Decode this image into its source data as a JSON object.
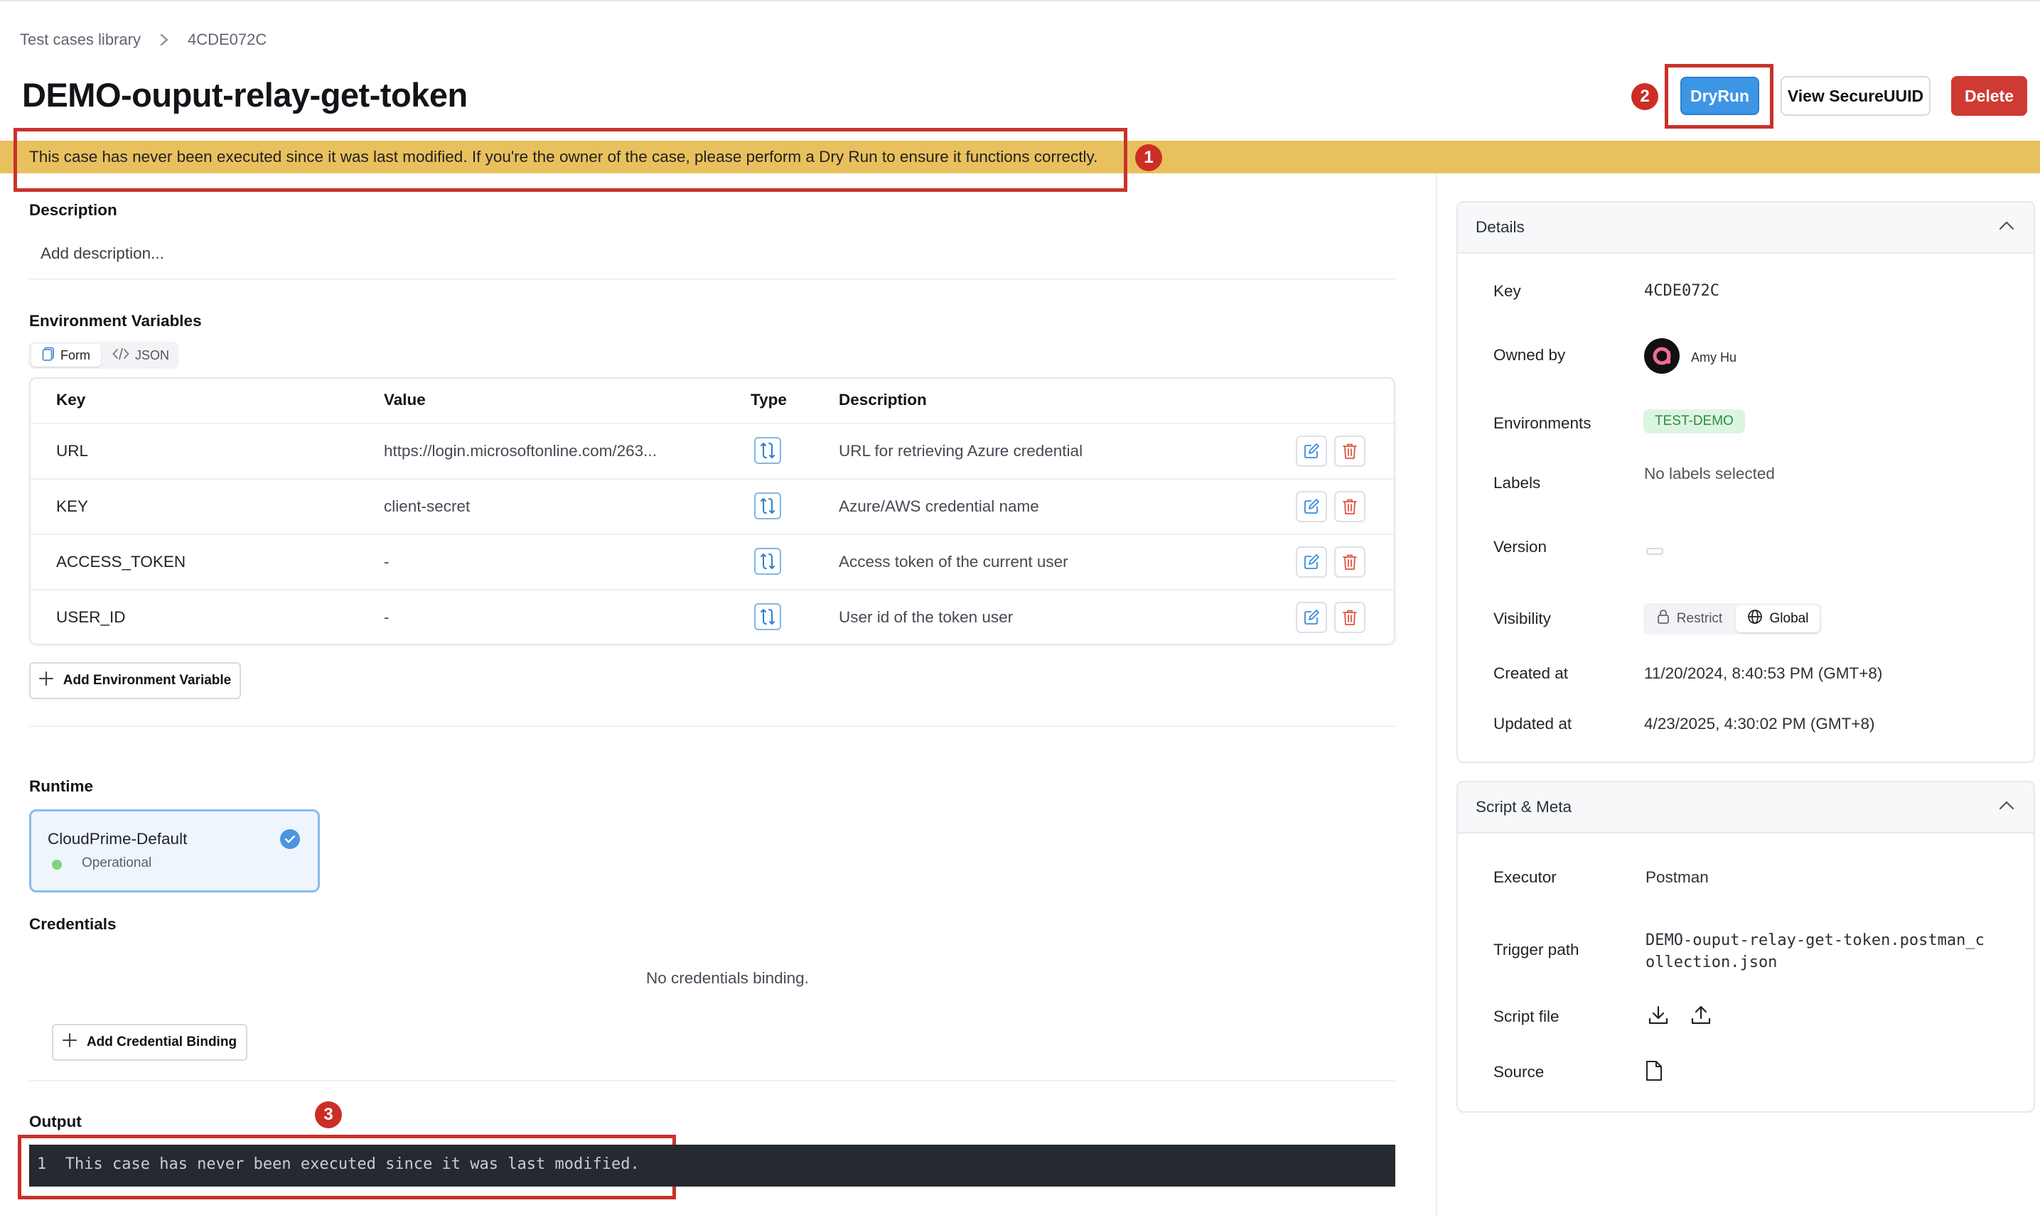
{
  "breadcrumb": {
    "root": "Test cases library",
    "current": "4CDE072C"
  },
  "page_title": "DEMO-ouput-relay-get-token",
  "header_buttons": {
    "dryrun": "DryRun",
    "view_uuid": "View SecureUUID",
    "delete": "Delete"
  },
  "warning_banner": "This case has never been executed since it was last modified. If you're the owner of the case, please perform a Dry Run to ensure it functions correctly.",
  "annotations": {
    "m1": "1",
    "m2": "2",
    "m3": "3"
  },
  "description": {
    "label": "Description",
    "placeholder": "Add description..."
  },
  "env_vars": {
    "label": "Environment Variables",
    "toggle": {
      "form": "Form",
      "json": "JSON"
    },
    "columns": {
      "key": "Key",
      "value": "Value",
      "type": "Type",
      "description": "Description"
    },
    "rows": [
      {
        "key": "URL",
        "value": "https://login.microsoftonline.com/263...",
        "description": "URL for retrieving Azure credential"
      },
      {
        "key": "KEY",
        "value": "client-secret",
        "description": "Azure/AWS credential name"
      },
      {
        "key": "ACCESS_TOKEN",
        "value": "-",
        "description": "Access token of the current user"
      },
      {
        "key": "USER_ID",
        "value": "-",
        "description": "User id of the token user"
      }
    ],
    "add_button": "Add Environment Variable"
  },
  "runtime": {
    "label": "Runtime",
    "name": "CloudPrime-Default",
    "status": "Operational",
    "status_color": "#7ed67a"
  },
  "credentials": {
    "label": "Credentials",
    "empty": "No credentials binding.",
    "add_button": "Add Credential Binding"
  },
  "output": {
    "label": "Output",
    "line_no": "1",
    "text": "This case has never been executed since it was last modified."
  },
  "details": {
    "title": "Details",
    "key_label": "Key",
    "key_value": "4CDE072C",
    "owner_label": "Owned by",
    "owner_name": "Amy Hu",
    "env_label": "Environments",
    "env_value": "TEST-DEMO",
    "labels_label": "Labels",
    "labels_value": "No labels selected",
    "version_label": "Version",
    "visibility_label": "Visibility",
    "visibility_restrict": "Restrict",
    "visibility_global": "Global",
    "created_label": "Created at",
    "created_value": "11/20/2024, 8:40:53 PM (GMT+8)",
    "updated_label": "Updated at",
    "updated_value": "4/23/2025, 4:30:02 PM (GMT+8)"
  },
  "script_meta": {
    "title": "Script & Meta",
    "executor_label": "Executor",
    "executor_value": "Postman",
    "trigger_label": "Trigger path",
    "trigger_line1": "DEMO-ouput-relay-get-token.postman_c",
    "trigger_line2": "ollection.json",
    "script_label": "Script file",
    "source_label": "Source"
  },
  "colors": {
    "accent": "#3d95e6",
    "danger": "#cf3a33",
    "banner": "#e8c15e",
    "annotation": "#c9322b"
  }
}
